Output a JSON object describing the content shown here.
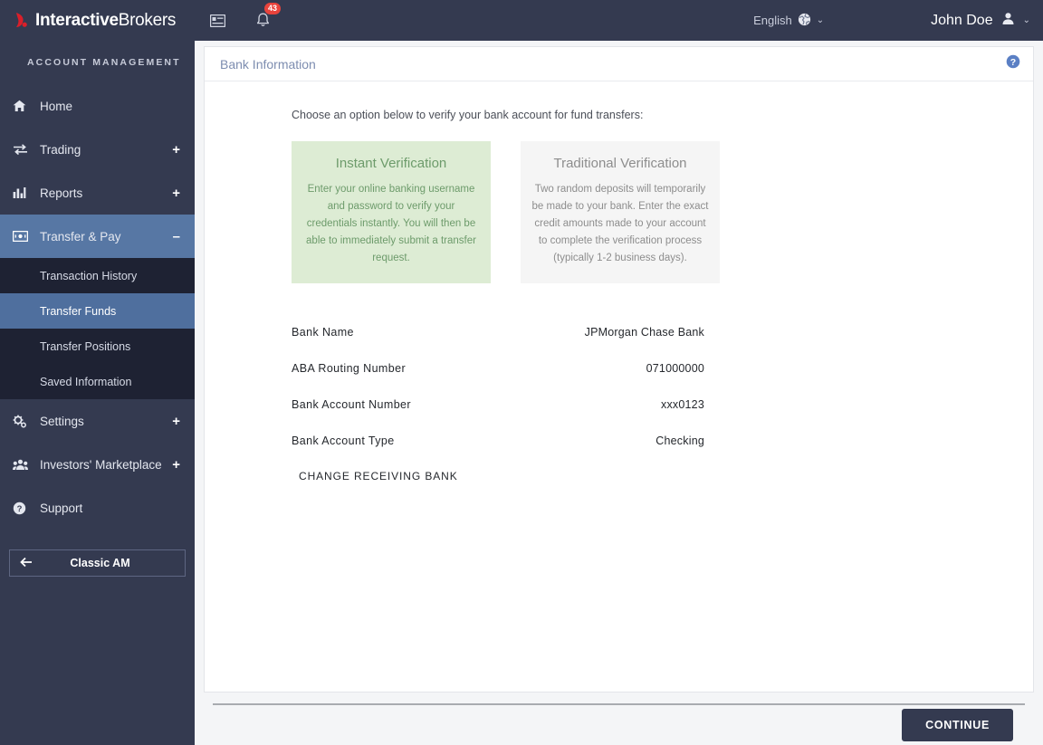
{
  "brand": {
    "name_bold": "Interactive",
    "name_light": "Brokers",
    "logo_icon": "ibkr-flame-logo-icon"
  },
  "topbar": {
    "menu_icon": "list-view-icon",
    "notifications_icon": "bell-icon",
    "notifications_count": "43",
    "language": "English",
    "language_icon": "globe-icon",
    "language_caret": "⌄",
    "user_name": "John Doe",
    "user_icon": "user-avatar-icon",
    "user_caret": "⌄"
  },
  "sidebar": {
    "section_title": "ACCOUNT MANAGEMENT",
    "items": [
      {
        "label": "Home",
        "icon": "home-icon",
        "expander": "",
        "active": false
      },
      {
        "label": "Trading",
        "icon": "exchange-arrows-icon",
        "expander": "+",
        "active": false
      },
      {
        "label": "Reports",
        "icon": "bar-chart-icon",
        "expander": "+",
        "active": false
      },
      {
        "label": "Transfer & Pay",
        "icon": "money-bill-icon",
        "expander": "–",
        "active": true
      },
      {
        "label": "Settings",
        "icon": "gears-icon",
        "expander": "+",
        "active": false
      },
      {
        "label": "Investors' Marketplace",
        "icon": "people-group-icon",
        "expander": "+",
        "active": false
      },
      {
        "label": "Support",
        "icon": "question-circle-icon",
        "expander": "",
        "active": false
      }
    ],
    "submenu": [
      {
        "label": "Transaction History",
        "active": false
      },
      {
        "label": "Transfer Funds",
        "active": true
      },
      {
        "label": "Transfer Positions",
        "active": false
      },
      {
        "label": "Saved Information",
        "active": false
      }
    ],
    "classic_button": {
      "label": "Classic AM",
      "icon": "arrow-left-icon"
    }
  },
  "panel": {
    "title": "Bank Information",
    "help_icon": "help-circle-icon"
  },
  "content": {
    "intro": "Choose an option below to verify your bank account for fund transfers:",
    "cards": [
      {
        "title": "Instant Verification",
        "text": "Enter your online banking username and password to verify your credentials instantly. You will then be able to immediately submit a transfer request.",
        "style": "green"
      },
      {
        "title": "Traditional Verification",
        "text": "Two random deposits will temporarily be made to your bank. Enter the exact credit amounts made to your account to complete the verification process (typically 1-2 business days).",
        "style": "gray"
      }
    ],
    "details": [
      {
        "label": "Bank Name",
        "value": "JPMorgan Chase Bank"
      },
      {
        "label": "ABA Routing  Number",
        "value": "071000000"
      },
      {
        "label": "Bank Account  Number",
        "value": "xxx0123"
      },
      {
        "label": "Bank Account  Type",
        "value": "Checking"
      }
    ],
    "change_bank_label": "CHANGE  RECEIVING  BANK"
  },
  "footer": {
    "continue_label": "CONTINUE"
  },
  "colors": {
    "navy": "#343a50",
    "submenu_dark": "#1e2233",
    "active_blue": "#5777a4",
    "sub_active_blue": "#4f6f9e",
    "badge_red": "#e8433c",
    "logo_red": "#d91f2a",
    "green_card_bg": "#ddecd4",
    "green_card_text": "#6d9b6b",
    "gray_card_bg": "#f5f5f5",
    "gray_card_text": "#8d8d8d",
    "panel_title": "#7d8db0",
    "help_blue": "#5a7fc4"
  }
}
